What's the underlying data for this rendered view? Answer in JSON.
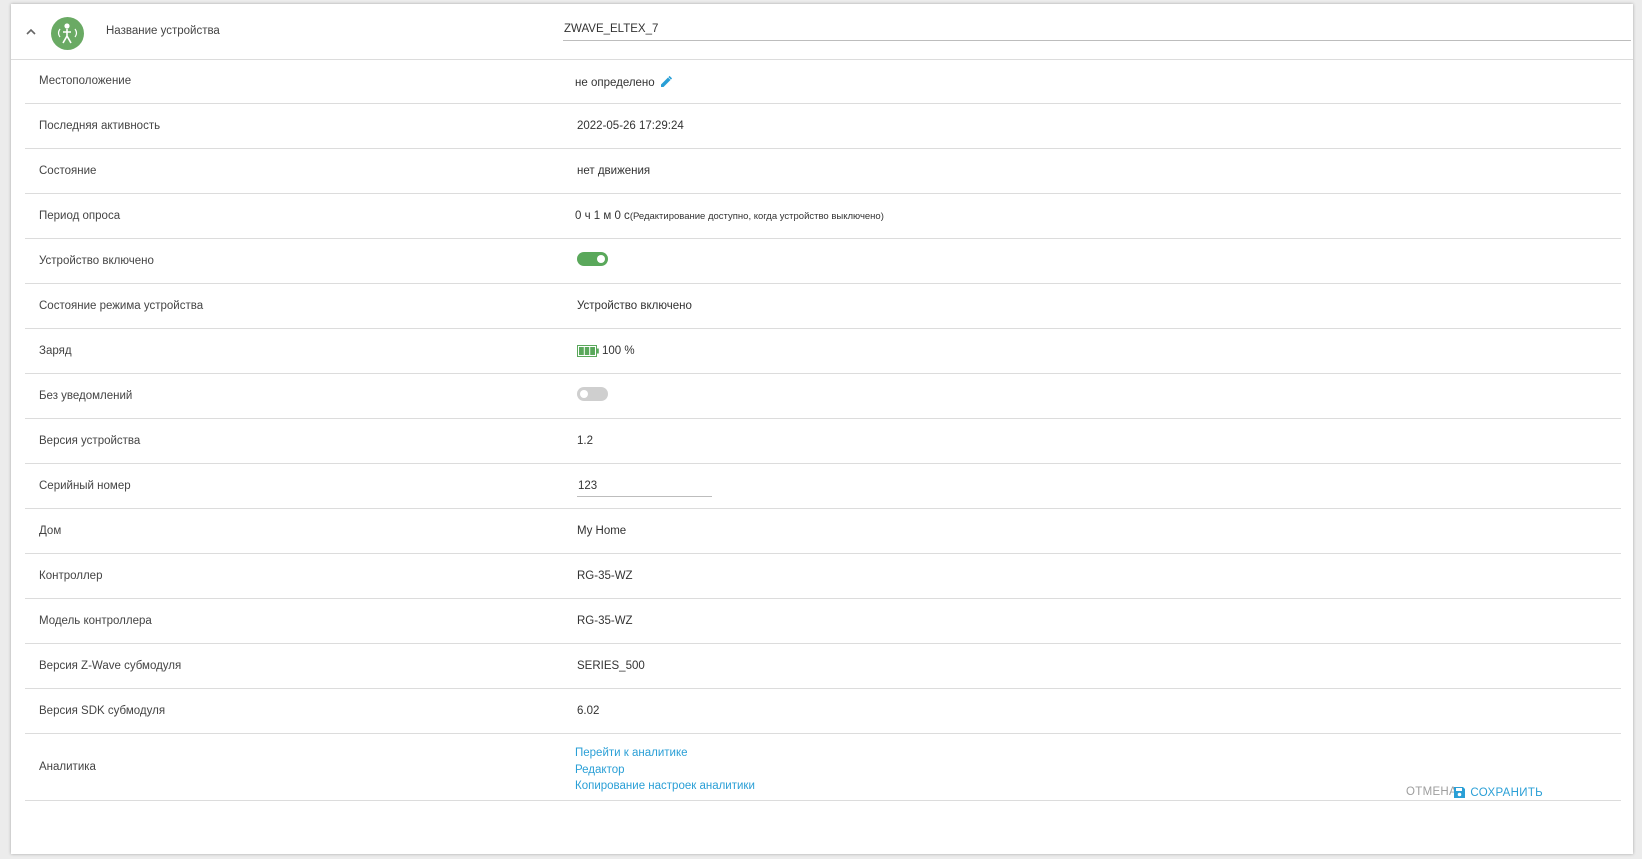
{
  "header": {
    "label": "Название устройства",
    "device_name": "ZWAVE_ELTEX_7",
    "avatar_icon": "motion-sensor-icon",
    "avatar_color": "#6aaa64"
  },
  "rows": {
    "location": {
      "label": "Местоположение",
      "value": "не определено"
    },
    "last_activity": {
      "label": "Последняя активность",
      "value": "2022-05-26 17:29:24"
    },
    "state": {
      "label": "Состояние",
      "value": "нет движения"
    },
    "poll_period": {
      "label": "Период опроса",
      "value": "0 ч 1 м 0 с",
      "hint": "(Редактирование доступно, когда устройство выключено)"
    },
    "device_enabled": {
      "label": "Устройство включено",
      "on": true
    },
    "mode_state": {
      "label": "Состояние режима устройства",
      "value": "Устройство включено"
    },
    "charge": {
      "label": "Заряд",
      "value": "100 %",
      "percent": 100
    },
    "no_notifications": {
      "label": "Без уведомлений",
      "on": false
    },
    "device_version": {
      "label": "Версия устройства",
      "value": "1.2"
    },
    "serial": {
      "label": "Серийный номер",
      "value": "123"
    },
    "home": {
      "label": "Дом",
      "value": "My Home"
    },
    "controller": {
      "label": "Контроллер",
      "value": "RG-35-WZ"
    },
    "controller_model": {
      "label": "Модель контроллера",
      "value": "RG-35-WZ"
    },
    "zwave_version": {
      "label": "Версия Z-Wave субмодуля",
      "value": "SERIES_500"
    },
    "sdk_version": {
      "label": "Версия SDK субмодуля",
      "value": "6.02"
    },
    "analytics": {
      "label": "Аналитика",
      "links": [
        "Перейти к аналитике",
        "Редактор",
        "Копирование настроек аналитики"
      ]
    }
  },
  "footer": {
    "cancel_label": "ОТМЕНА",
    "save_label": "СОХРАНИТЬ"
  },
  "colors": {
    "accent": "#2a9fd6",
    "toggle_on": "#5aa85b",
    "battery": "#5aa85b"
  }
}
